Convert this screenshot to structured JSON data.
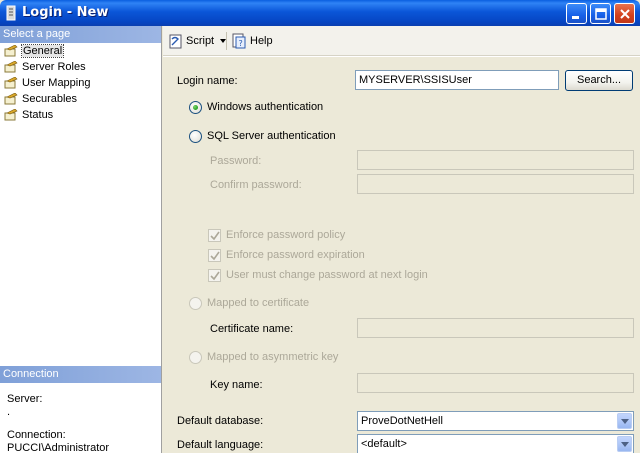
{
  "window": {
    "title": "Login - New",
    "controls": [
      "minimize-icon",
      "maximize-icon",
      "close-icon"
    ]
  },
  "left_pane": {
    "select_page_header": "Select a page",
    "pages": [
      {
        "label": "General",
        "selected": true,
        "icon": "page-icon"
      },
      {
        "label": "Server Roles",
        "icon": "page-icon"
      },
      {
        "label": "User Mapping",
        "icon": "page-icon"
      },
      {
        "label": "Securables",
        "icon": "page-icon"
      },
      {
        "label": "Status",
        "icon": "page-icon"
      }
    ],
    "connection_header": "Connection",
    "server_label": "Server:",
    "server_value": ".",
    "connection_label": "Connection:",
    "connection_value": "PUCCI\\Administrator"
  },
  "toolbar": {
    "script_label": "Script",
    "help_label": "Help"
  },
  "form": {
    "login_name_label": "Login name:",
    "login_name_value": "MYSERVER\\SSISUser",
    "search_button": "Search...",
    "windows_auth_label": "Windows authentication",
    "sql_auth_label": "SQL Server authentication",
    "password_label": "Password:",
    "confirm_password_label": "Confirm password:",
    "enforce_policy_label": "Enforce password policy",
    "enforce_expiration_label": "Enforce password expiration",
    "must_change_label": "User must change password at next login",
    "mapped_certificate_label": "Mapped to certificate",
    "certificate_name_label": "Certificate name:",
    "mapped_asymmetric_label": "Mapped to asymmetric key",
    "key_name_label": "Key name:",
    "default_database_label": "Default database:",
    "default_database_value": "ProveDotNetHell",
    "default_language_label": "Default language:",
    "default_language_value": "<default>"
  },
  "colors": {
    "title_bar": "#0a56d8",
    "section_header": "#8aa8dc",
    "form_background": "#ece9d8"
  }
}
